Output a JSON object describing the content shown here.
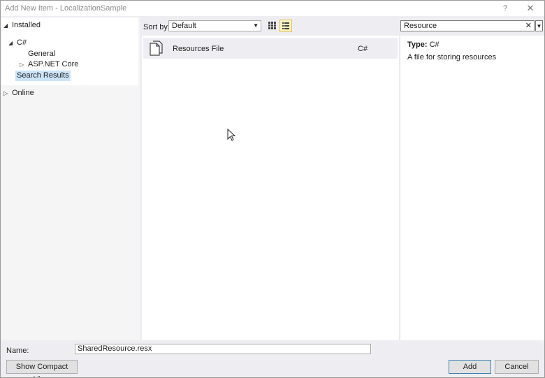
{
  "window": {
    "title": "Add New Item - LocalizationSample",
    "help_glyph": "?",
    "close_glyph": "✕"
  },
  "tree": {
    "installed": "Installed",
    "csharp": "C#",
    "general": "General",
    "aspnet": "ASP.NET Core",
    "search_results": "Search Results",
    "online": "Online"
  },
  "toolbar": {
    "sort_label": "Sort by:",
    "sort_value": "Default",
    "search_value": "Resource",
    "clear_glyph": "✕"
  },
  "templates": [
    {
      "name": "Resources File",
      "lang": "C#"
    }
  ],
  "detail": {
    "type_label": "Type:",
    "type_value": "C#",
    "description": "A file for storing resources"
  },
  "footer": {
    "name_label": "Name:",
    "name_value": "SharedResource.resx",
    "compact_view": "Show Compact View",
    "add": "Add",
    "cancel": "Cancel"
  }
}
